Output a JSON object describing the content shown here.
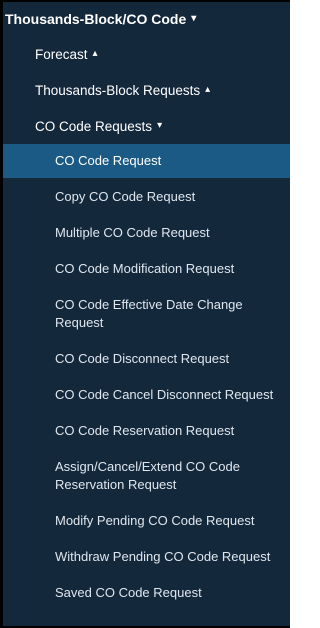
{
  "menu": {
    "header": {
      "label": "Thousands-Block/CO Code",
      "caret": "▾"
    },
    "sections": [
      {
        "label": "Forecast",
        "caret": "▴"
      },
      {
        "label": "Thousands-Block Requests",
        "caret": "▴"
      },
      {
        "label": "CO Code Requests",
        "caret": "▾"
      }
    ],
    "items": [
      {
        "label": "CO Code Request",
        "active": true
      },
      {
        "label": "Copy CO Code Request"
      },
      {
        "label": "Multiple CO Code Request"
      },
      {
        "label": "CO Code Modification Request"
      },
      {
        "label": "CO Code Effective Date Change Request"
      },
      {
        "label": "CO Code Disconnect Request"
      },
      {
        "label": "CO Code Cancel Disconnect Request"
      },
      {
        "label": "CO Code Reservation Request"
      },
      {
        "label": "Assign/Cancel/Extend CO Code Reservation Request"
      },
      {
        "label": "Modify Pending CO Code Request"
      },
      {
        "label": "Withdraw Pending CO Code Request"
      },
      {
        "label": "Saved CO Code Request"
      }
    ]
  },
  "colors": {
    "panel_bg": "#14283c",
    "active_bg": "#1b5a84",
    "text": "#ffffff"
  }
}
